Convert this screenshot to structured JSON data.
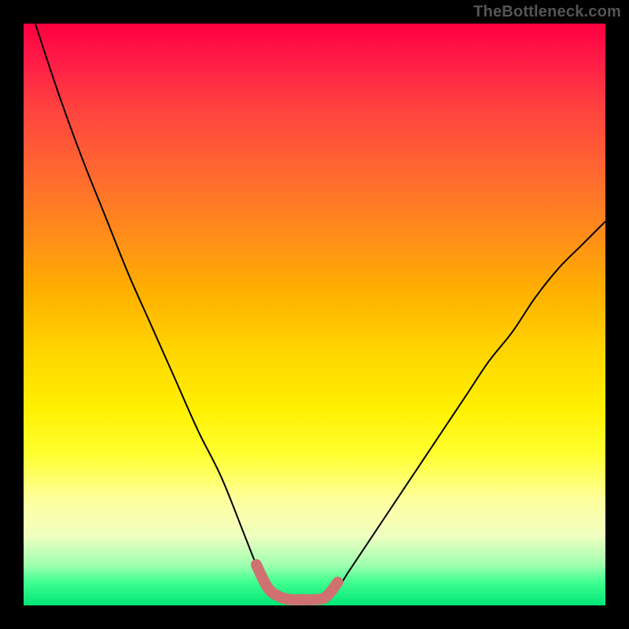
{
  "watermark": "TheBottleneck.com",
  "chart_data": {
    "type": "line",
    "title": "",
    "xlabel": "",
    "ylabel": "",
    "xlim": [
      0,
      100
    ],
    "ylim": [
      0,
      100
    ],
    "grid": false,
    "legend": false,
    "annotations": [],
    "background_gradient": {
      "top": "#ff0040",
      "middle": "#ffff30",
      "bottom": "#00e676"
    },
    "series": [
      {
        "name": "left-curve",
        "x": [
          2,
          6,
          10,
          14,
          18,
          22,
          26,
          30,
          34,
          38,
          40,
          42,
          44
        ],
        "values": [
          100,
          88,
          77,
          67,
          57,
          48,
          39,
          30,
          22,
          12,
          7,
          3,
          1.5
        ]
      },
      {
        "name": "right-curve",
        "x": [
          52,
          54,
          56,
          60,
          64,
          68,
          72,
          76,
          80,
          84,
          88,
          92,
          96,
          100
        ],
        "values": [
          1.5,
          3,
          6,
          12,
          18,
          24,
          30,
          36,
          42,
          47,
          53,
          58,
          62,
          66
        ]
      },
      {
        "name": "valley-highlight",
        "x": [
          40,
          42,
          44,
          46,
          48,
          50,
          52,
          54
        ],
        "values": [
          7,
          3,
          1.5,
          1,
          1,
          1,
          1.5,
          4
        ],
        "style": "thick-marker",
        "color": "#d07070"
      }
    ]
  }
}
